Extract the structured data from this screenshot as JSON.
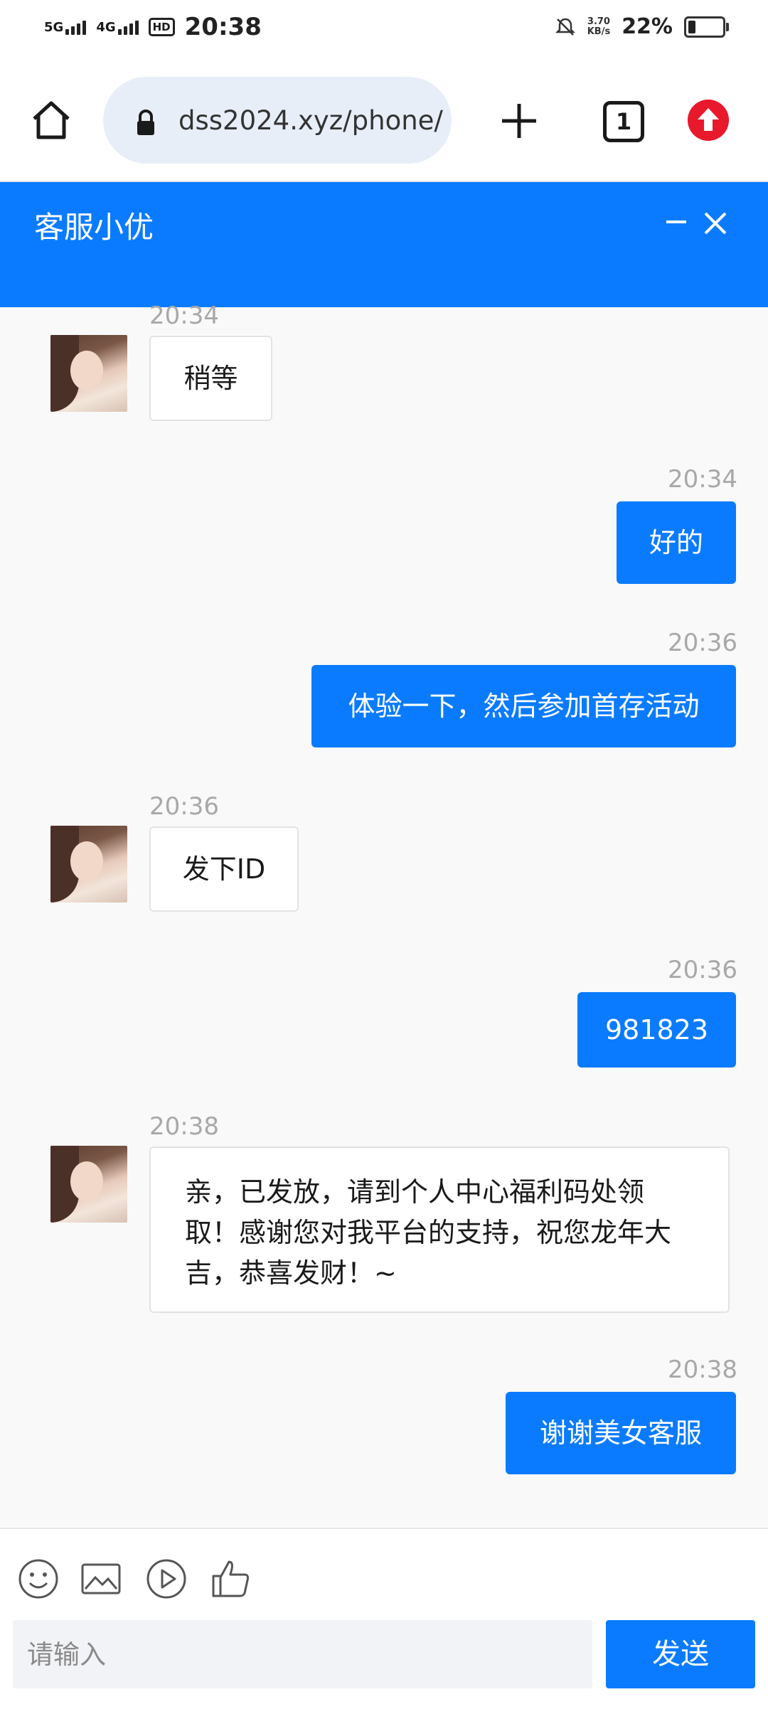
{
  "status_bar": {
    "network1": "5G",
    "network2": "4G",
    "hd": "HD",
    "time": "20:38",
    "speed_value": "3.70",
    "speed_unit": "KB/s",
    "battery_percent": "22%"
  },
  "browser": {
    "url": "dss2024.xyz/phone/",
    "tab_count": "1"
  },
  "chat": {
    "agent_name": "客服小优",
    "messages": [
      {
        "time": "20:34",
        "text": "稍等",
        "side": "in"
      },
      {
        "time": "20:34",
        "text": "好的",
        "side": "out"
      },
      {
        "time": "20:36",
        "text": "体验一下，然后参加首存活动",
        "side": "out"
      },
      {
        "time": "20:36",
        "text": "发下ID",
        "side": "in"
      },
      {
        "time": "20:36",
        "text": "981823",
        "side": "out"
      },
      {
        "time": "20:38",
        "text_lines": [
          "亲，已发放，请到个人中心福利码处领",
          "取！感谢您对我平台的支持，祝您龙年大",
          "吉，恭喜发财！~"
        ],
        "side": "in"
      },
      {
        "time": "20:38",
        "text": "谢谢美女客服",
        "side": "out"
      }
    ]
  },
  "composer": {
    "placeholder": "请输入",
    "send_label": "发送"
  },
  "colors": {
    "accent": "#0a7bff",
    "update_badge": "#e8192c"
  }
}
